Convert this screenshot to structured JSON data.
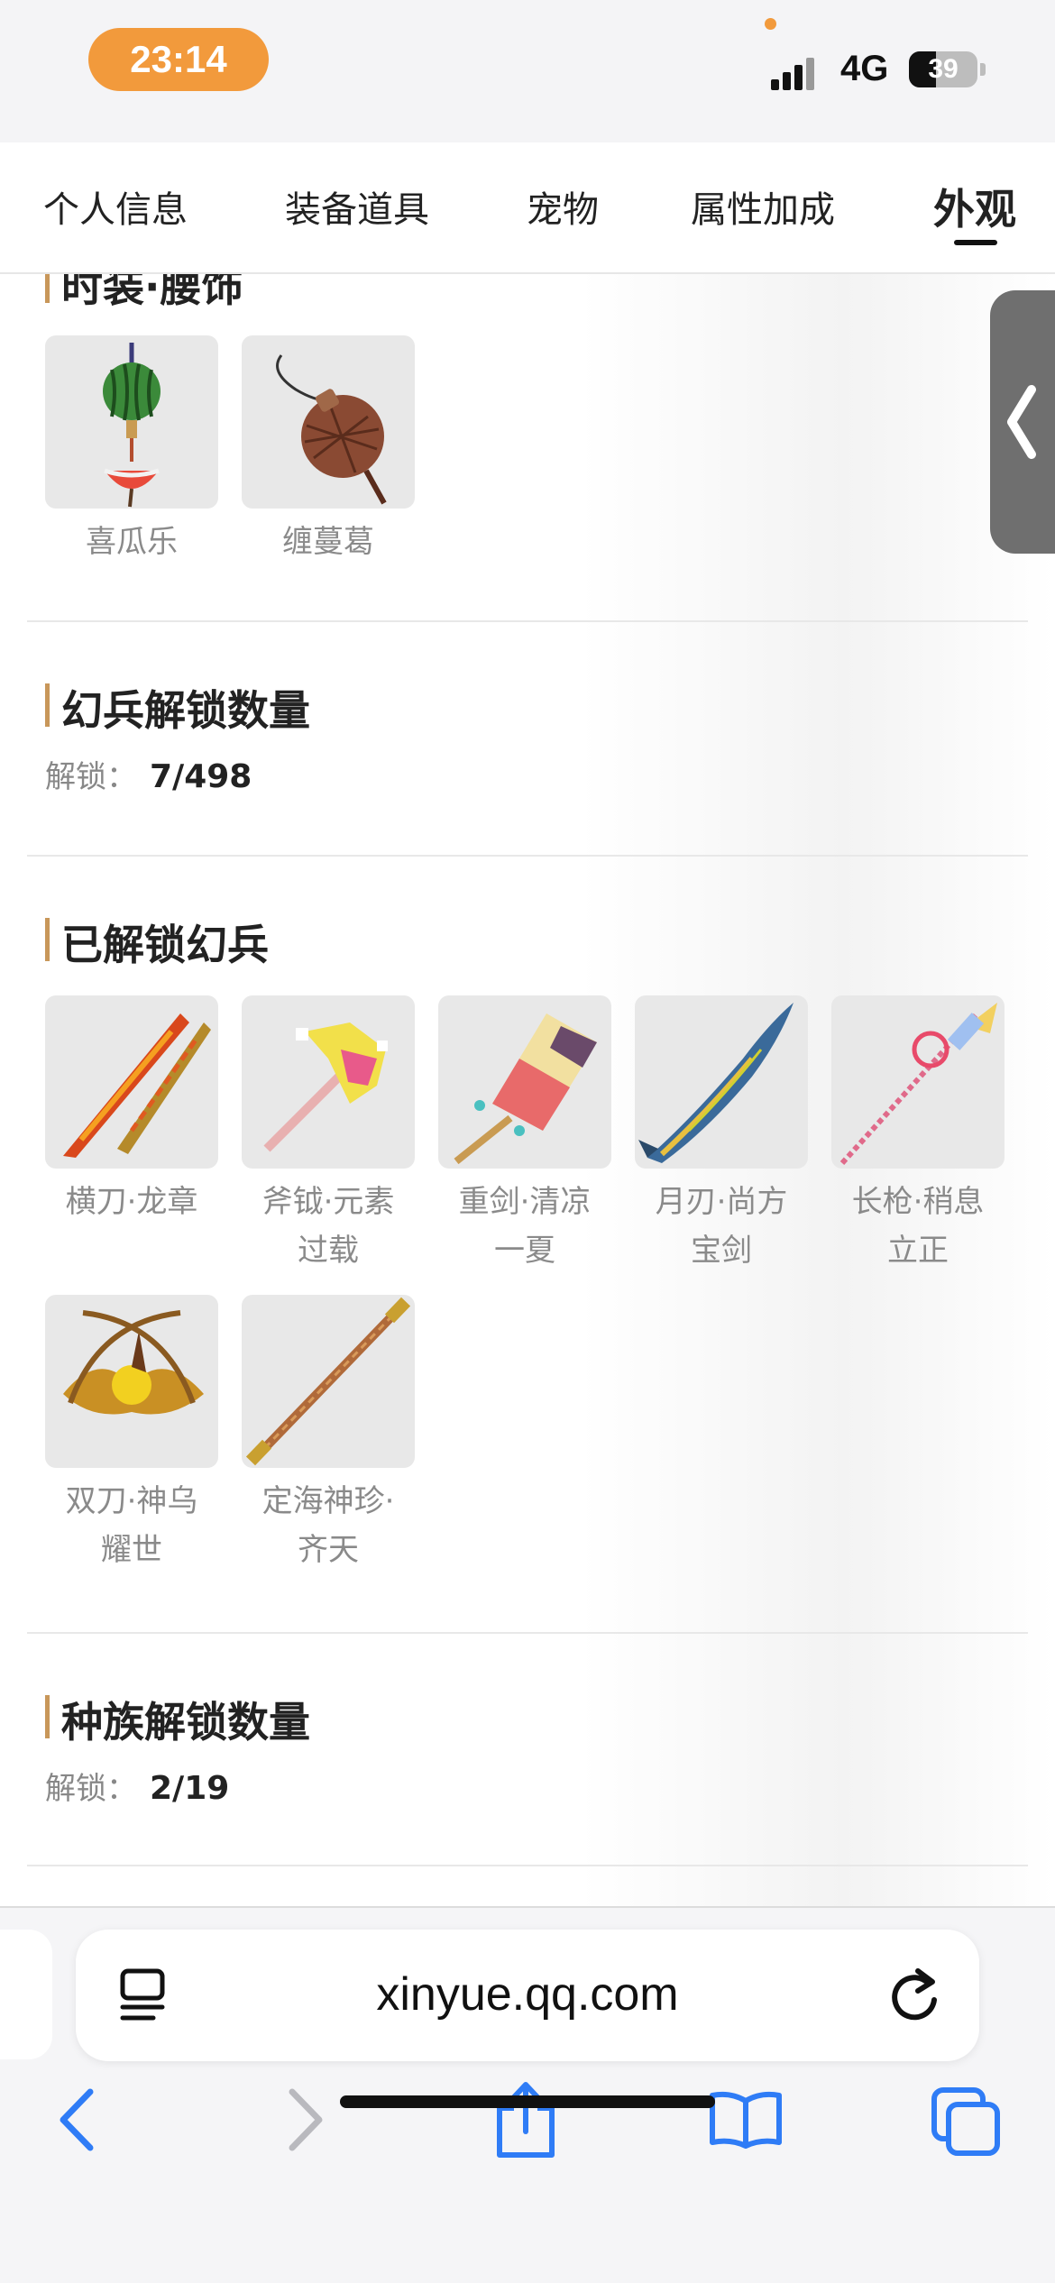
{
  "status": {
    "time": "23:14",
    "network": "4G",
    "battery_percent": 39,
    "battery_label": "39"
  },
  "tabs": [
    {
      "label": "个人信息",
      "active": false
    },
    {
      "label": "装备道具",
      "active": false
    },
    {
      "label": "宠物",
      "active": false
    },
    {
      "label": "属性加成",
      "active": false
    },
    {
      "label": "外观",
      "active": true
    }
  ],
  "fashion_waist": {
    "title": "时装·腰饰",
    "items": [
      {
        "name": "喜瓜乐",
        "icon": "watermelon-charm-icon"
      },
      {
        "name": "缠蔓葛",
        "icon": "gourd-charm-icon"
      }
    ]
  },
  "illusion_weapon_count": {
    "title": "幻兵解锁数量",
    "label": "解锁：",
    "value": "7/498"
  },
  "unlocked_weapons": {
    "title": "已解锁幻兵",
    "items": [
      {
        "name_lines": [
          "横刀·龙章"
        ],
        "icon": "dragon-sabre-icon"
      },
      {
        "name_lines": [
          "斧钺·元素",
          "过载"
        ],
        "icon": "element-axe-icon"
      },
      {
        "name_lines": [
          "重剑·清凉",
          "一夏"
        ],
        "icon": "popsicle-sword-icon"
      },
      {
        "name_lines": [
          "月刃·尚方",
          "宝剑"
        ],
        "icon": "fish-blade-icon"
      },
      {
        "name_lines": [
          "长枪·稍息",
          "立正"
        ],
        "icon": "candy-spear-icon"
      },
      {
        "name_lines": [
          "双刀·神乌",
          "耀世"
        ],
        "icon": "golden-crow-blades-icon"
      },
      {
        "name_lines": [
          "定海神珍·",
          "齐天"
        ],
        "icon": "golden-staff-icon"
      }
    ]
  },
  "race_count": {
    "title": "种族解锁数量",
    "label": "解锁：",
    "value": "2/19"
  },
  "browser": {
    "url": "xinyue.qq.com"
  },
  "colors": {
    "accent_orange": "#f29a3c",
    "section_bar": "#c8975a",
    "safari_blue": "#2f7cf6"
  }
}
